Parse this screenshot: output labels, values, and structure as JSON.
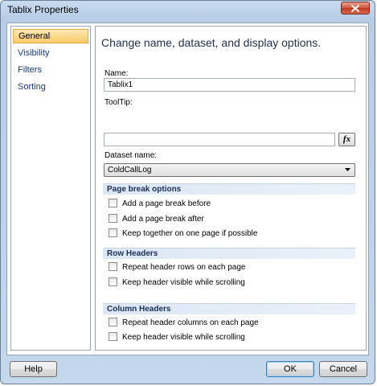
{
  "window": {
    "title": "Tablix Properties"
  },
  "nav": {
    "items": [
      {
        "label": "General",
        "selected": true
      },
      {
        "label": "Visibility",
        "selected": false
      },
      {
        "label": "Filters",
        "selected": false
      },
      {
        "label": "Sorting",
        "selected": false
      }
    ]
  },
  "general": {
    "heading": "Change name, dataset, and display options.",
    "name_label": "Name:",
    "name_value": "Tablix1",
    "tooltip_label": "ToolTip:",
    "tooltip_value": "",
    "fx_label": "fx",
    "dataset_label": "Dataset name:",
    "dataset_value": "ColdCallLog"
  },
  "page_break": {
    "header": "Page break options",
    "options": [
      {
        "label": "Add a page break before",
        "checked": false
      },
      {
        "label": "Add a page break after",
        "checked": false
      },
      {
        "label": "Keep together on one page if possible",
        "checked": false
      }
    ]
  },
  "row_headers": {
    "header": "Row Headers",
    "options": [
      {
        "label": "Repeat header rows on each page",
        "checked": false
      },
      {
        "label": "Keep header visible while scrolling",
        "checked": false
      }
    ]
  },
  "column_headers": {
    "header": "Column Headers",
    "options": [
      {
        "label": "Repeat header columns on each page",
        "checked": false
      },
      {
        "label": "Keep header visible while scrolling",
        "checked": false
      }
    ]
  },
  "footer": {
    "help_label": "Help",
    "ok_label": "OK",
    "cancel_label": "Cancel"
  },
  "icons": {
    "close": "close-icon",
    "dropdown": "chevron-down-icon"
  },
  "colors": {
    "selected_nav": "#f9c968",
    "section_bar": "#dce7f4",
    "close_button": "#c0391f"
  }
}
